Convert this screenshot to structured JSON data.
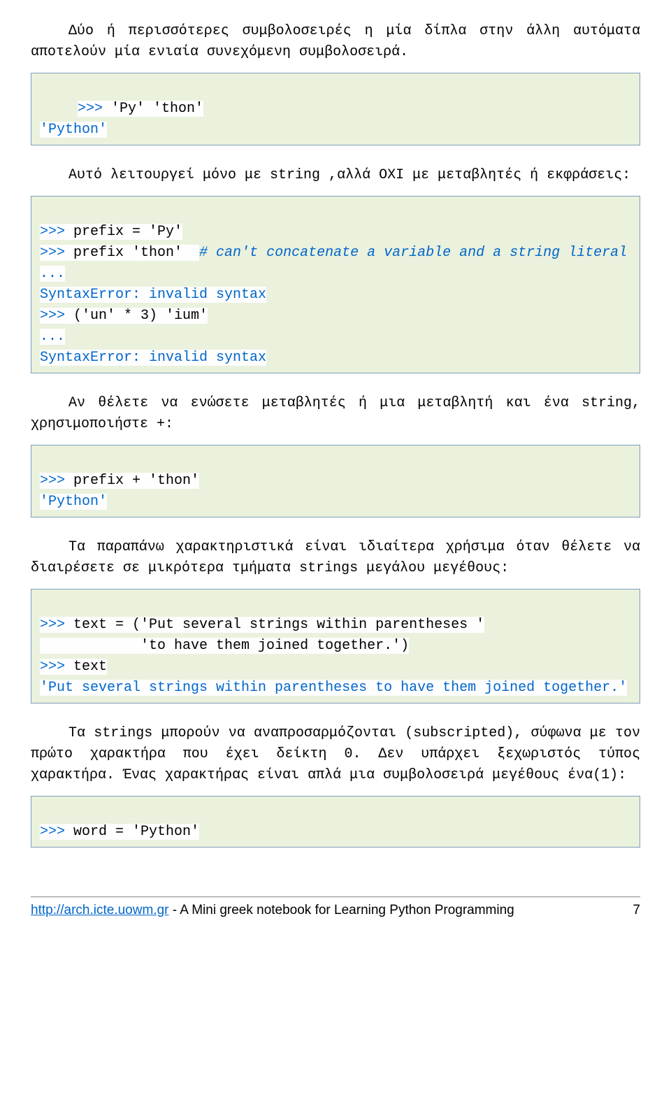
{
  "para1": "Δύο ή περισσότερες συμβολοσειρές η μία δίπλα στην άλλη αυτόματα αποτελούν μία ενιαία συνεχόμενη συμβολοσειρά.",
  "code1": {
    "l1a": ">>>",
    "l1b": " 'Py' 'thon'",
    "l2": "'Python'"
  },
  "para2": "Αυτό λειτουργεί μόνο με string ,αλλά ΟΧΙ με μεταβλητές ή εκφράσεις:",
  "code2": {
    "l1a": ">>>",
    "l1b": " prefix = 'Py'",
    "l2a": ">>>",
    "l2b": " prefix 'thon'  ",
    "l2c": "# can't concatenate a variable and a string literal",
    "l3": "...",
    "l4": "SyntaxError: invalid syntax",
    "l5a": ">>>",
    "l5b": " ('un' * 3) 'ium'",
    "l6": "...",
    "l7": "SyntaxError: invalid syntax"
  },
  "para3": "Αν θέλετε να ενώσετε μεταβλητές ή μια μεταβλητή και ένα string, χρησιμοποιήστε +:",
  "code3": {
    "l1a": ">>>",
    "l1b": " prefix + 'thon'",
    "l2": "'Python'"
  },
  "para4": "Τα παραπάνω χαρακτηριστικά είναι ιδιαίτερα χρήσιμα όταν θέλετε να διαιρέσετε σε μικρότερα τμήματα strings μεγάλου μεγέθους:",
  "code4": {
    "l1a": ">>>",
    "l1b": " text = ('Put several strings within parentheses '",
    "l2": "            'to have them joined together.')",
    "l3a": ">>>",
    "l3b": " text",
    "l4": "'Put several strings within parentheses to have them joined together.'"
  },
  "para5": "Τα strings μπορούν να αναπροσαρμόζονται (subscripted), σύφωνα με τον πρώτο χαρακτήρα που έχει δείκτη 0. Δεν υπάρχει ξεχωριστός τύπος χαρακτήρα. Ένας χαρακτήρας είναι απλά μια συμβολοσειρά μεγέθους ένα(1):",
  "code5": {
    "l1a": ">>>",
    "l1b": " word = 'Python'"
  },
  "footer": {
    "url": "http://arch.icte.uowm.gr",
    "text": " - A Mini greek notebook for Learning Python Programming",
    "page": "7"
  }
}
